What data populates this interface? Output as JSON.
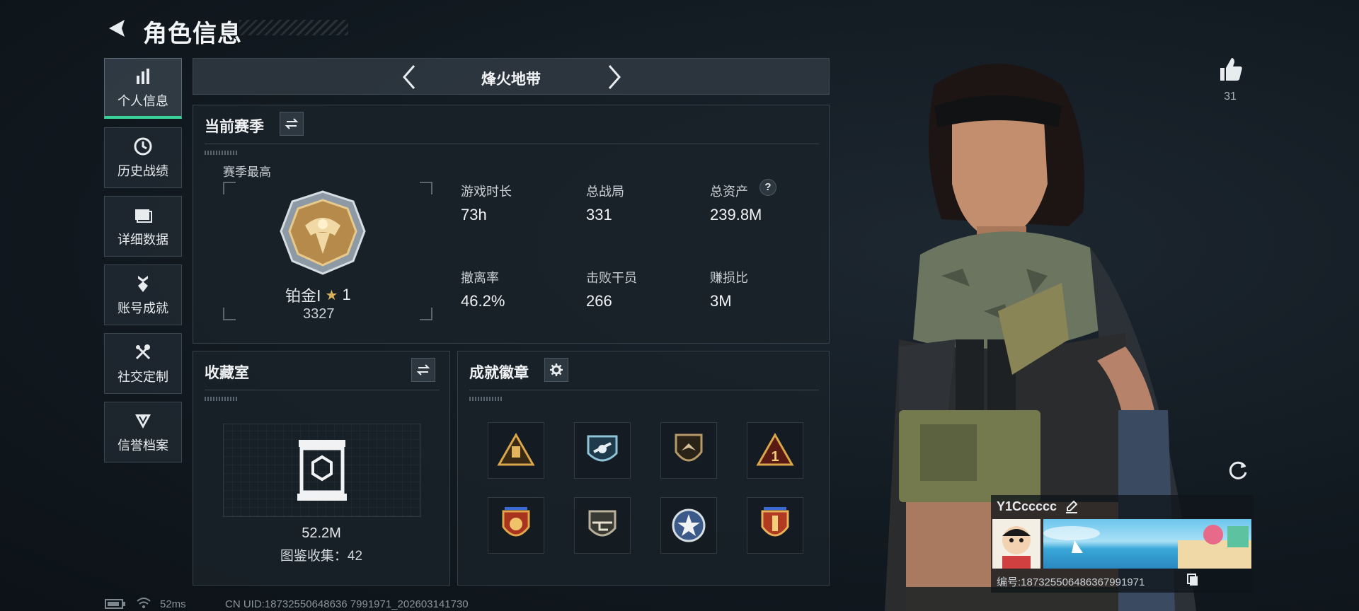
{
  "header": {
    "title": "角色信息"
  },
  "nav": {
    "items": [
      {
        "label": "个人信息",
        "icon": "bar-chart-icon"
      },
      {
        "label": "历史战绩",
        "icon": "clock-icon"
      },
      {
        "label": "详细数据",
        "icon": "folder-icon"
      },
      {
        "label": "账号成就",
        "icon": "medal-icon"
      },
      {
        "label": "社交定制",
        "icon": "tools-icon"
      },
      {
        "label": "信誉档案",
        "icon": "shield-icon"
      }
    ]
  },
  "mode": {
    "title": "烽火地带"
  },
  "season": {
    "title": "当前赛季",
    "best_label": "赛季最高",
    "rank_name": "铂金Ⅰ",
    "rank_stars": "1",
    "rank_score": "3327",
    "stats": [
      {
        "label": "游戏时长",
        "value": "73h"
      },
      {
        "label": "总战局",
        "value": "331"
      },
      {
        "label": "总资产",
        "value": "239.8M"
      },
      {
        "label": "撤离率",
        "value": "46.2%"
      },
      {
        "label": "击败干员",
        "value": "266"
      },
      {
        "label": "赚损比",
        "value": "3M"
      }
    ],
    "help": "?"
  },
  "collection": {
    "title": "收藏室",
    "value": "52.2M",
    "count_text": "图鉴收集：42"
  },
  "achievements": {
    "title": "成就徽章",
    "badges": [
      "badge-warning-icon",
      "badge-wing-icon",
      "badge-bird-icon",
      "badge-number-icon",
      "badge-crest-icon",
      "badge-helicopter-icon",
      "badge-star-icon",
      "badge-rocket-icon"
    ]
  },
  "profile": {
    "likes": "31",
    "name": "Y1Cccccc",
    "id_text": "编号:1873255064863679919​71"
  },
  "status": {
    "ping": "52ms",
    "uid": "CN UID:18732550648636 7991971_202603141730"
  },
  "colors": {
    "accent": "#38d39a",
    "gold": "#c8a15a"
  }
}
